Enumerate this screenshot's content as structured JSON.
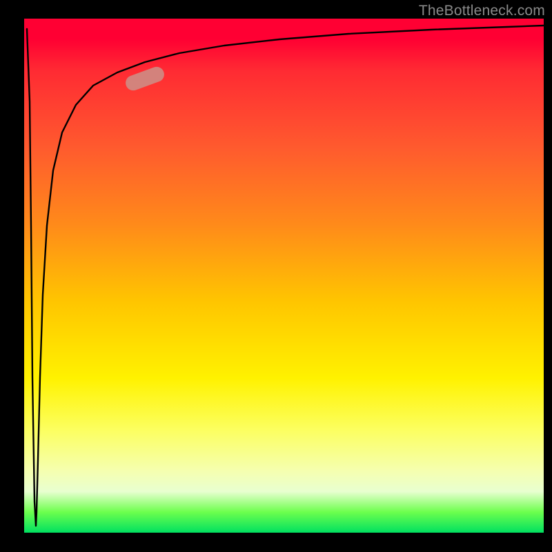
{
  "watermark": {
    "text": "TheBottleneck.com"
  },
  "colors": {
    "frame": "#000000",
    "curve": "#000000",
    "highlight": "#cf8a82",
    "gradient_top": "#ff0033",
    "gradient_bottom": "#00e060",
    "watermark": "#8a8a8a"
  },
  "chart_data": {
    "type": "line",
    "title": "",
    "xlabel": "",
    "ylabel": "",
    "xlim": [
      0,
      100
    ],
    "ylim": [
      0,
      100
    ],
    "grid": false,
    "annotations": [
      {
        "kind": "highlight-segment",
        "x_range": [
          20,
          27
        ],
        "y_range": [
          84,
          88
        ],
        "color": "#cf8a82"
      }
    ],
    "series": [
      {
        "name": "bottleneck-curve",
        "x": [
          0.5,
          1.0,
          1.3,
          1.7,
          2.0,
          2.2,
          2.6,
          3.0,
          3.6,
          4.5,
          6.0,
          8.0,
          11,
          15,
          20,
          27,
          35,
          45,
          60,
          80,
          100
        ],
        "y": [
          98,
          70,
          40,
          10,
          2,
          8,
          25,
          40,
          55,
          65,
          72,
          78,
          82,
          85,
          87,
          89,
          91,
          93,
          95,
          97,
          98
        ]
      }
    ]
  }
}
